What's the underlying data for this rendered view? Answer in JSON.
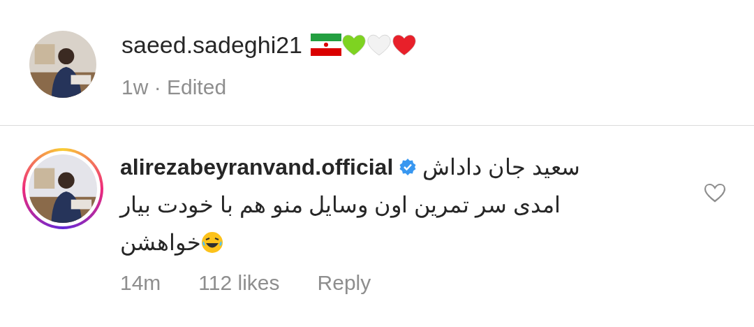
{
  "post": {
    "username": "saeed.sadeghi21",
    "symbols": [
      {
        "kind": "flag"
      },
      {
        "kind": "heart",
        "color": "#7ed321"
      },
      {
        "kind": "heart",
        "color": "#f2f2f2"
      },
      {
        "kind": "heart",
        "color": "#e8202a"
      }
    ],
    "time": "1w",
    "separator": "·",
    "edited": "Edited"
  },
  "comment": {
    "story_ring": true,
    "username": "alirezabeyranvand.official",
    "verified": true,
    "lines": [
      {
        "kind": "plain",
        "text": "سعید جان داداش"
      },
      {
        "kind": "plain",
        "text": "امدی سر تمرین اون وسایل منو هم با خودت بیار"
      },
      {
        "kind": "emoji",
        "text": "خواهشن"
      }
    ],
    "liked": false,
    "time": "14m",
    "likes": "112 likes",
    "reply": "Reply"
  }
}
